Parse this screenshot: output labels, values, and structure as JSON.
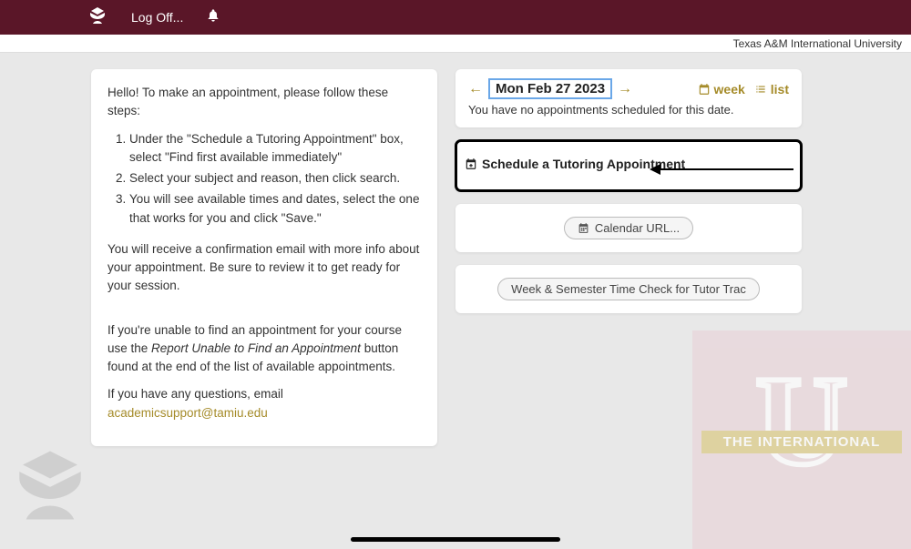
{
  "topbar": {
    "logoff": "Log Off..."
  },
  "subbar": {
    "org": "Texas A&M International University"
  },
  "instructions": {
    "intro": "Hello! To make an appointment, please follow these steps:",
    "steps": [
      "Under the \"Schedule a Tutoring Appointment\" box, select \"Find first available immediately\"",
      "Select your subject and reason, then click search.",
      "You will see available times and dates, select the one that works for you and click \"Save.\""
    ],
    "confirm": "You will receive a confirmation email with more info about your appointment. Be sure to review it to get ready for your session.",
    "unable_prefix": "If you're unable to find an appointment for your course use the ",
    "unable_italic": "Report Unable to Find an Appointment",
    "unable_suffix": " button found at the end of the list of available appointments.",
    "questions_prefix": "If you have any questions, email ",
    "email": "academicsupport@tamiu.edu"
  },
  "datecard": {
    "date": "Mon Feb 27 2023",
    "week": "week",
    "list": "list",
    "msg": "You have no appointments scheduled for this date."
  },
  "schedule": {
    "label": "Schedule a Tutoring Appointment"
  },
  "calendar": {
    "label": "Calendar URL..."
  },
  "timecheck": {
    "label": "Week & Semester Time Check for Tutor Trac"
  },
  "watermark": {
    "banner": "THE INTERNATIONAL"
  }
}
